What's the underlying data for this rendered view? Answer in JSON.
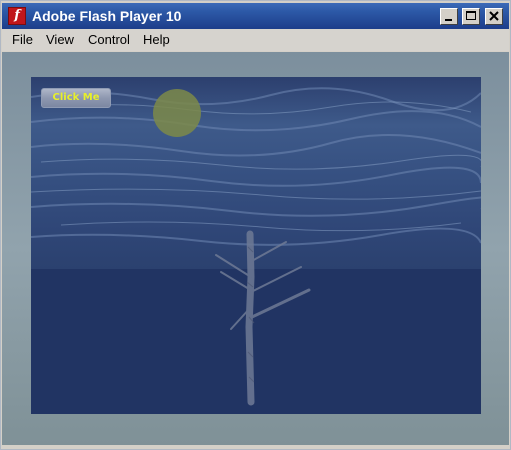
{
  "window": {
    "title": "Adobe Flash Player 10",
    "controls": {
      "minimize_icon": "minimize-icon",
      "maximize_icon": "maximize-icon",
      "close_icon": "close-icon"
    },
    "title_gradient_color": "#2d5aa8"
  },
  "menubar": {
    "items": [
      {
        "label": "File"
      },
      {
        "label": "View"
      },
      {
        "label": "Control"
      },
      {
        "label": "Help"
      }
    ]
  },
  "stage": {
    "button_label": "Click Me",
    "button_text_color": "#e8f02a",
    "moon_color": "#7c8a49",
    "sky_color": "#3e5a8a",
    "water_color": "#213463"
  }
}
